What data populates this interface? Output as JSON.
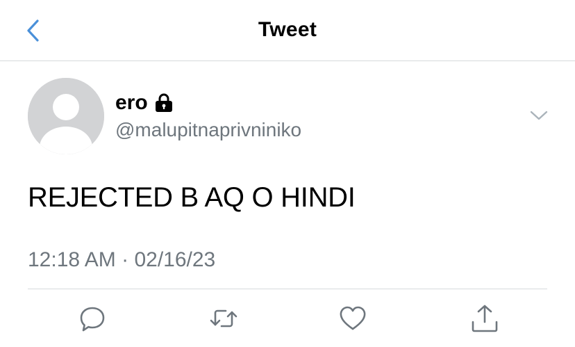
{
  "header": {
    "title": "Tweet",
    "back_icon": "chevron-left-icon",
    "accent_color": "#4a90d9"
  },
  "tweet": {
    "author": {
      "name": "ero",
      "handle": "@malupitnaprivniniko",
      "protected_icon": "lock-icon",
      "avatar": "default-avatar"
    },
    "menu_icon": "chevron-down-icon",
    "text": "REJECTED B AQ O HINDI",
    "time": "12:18 AM",
    "separator": "·",
    "date": "02/16/23"
  },
  "actions": [
    {
      "name": "reply",
      "icon": "reply-icon"
    },
    {
      "name": "retweet",
      "icon": "retweet-icon"
    },
    {
      "name": "like",
      "icon": "heart-icon"
    },
    {
      "name": "share",
      "icon": "share-icon"
    }
  ],
  "colors": {
    "text_primary": "#000000",
    "text_secondary": "#6e767d",
    "divider": "#d6d9dc",
    "icon": "#6e767d"
  }
}
